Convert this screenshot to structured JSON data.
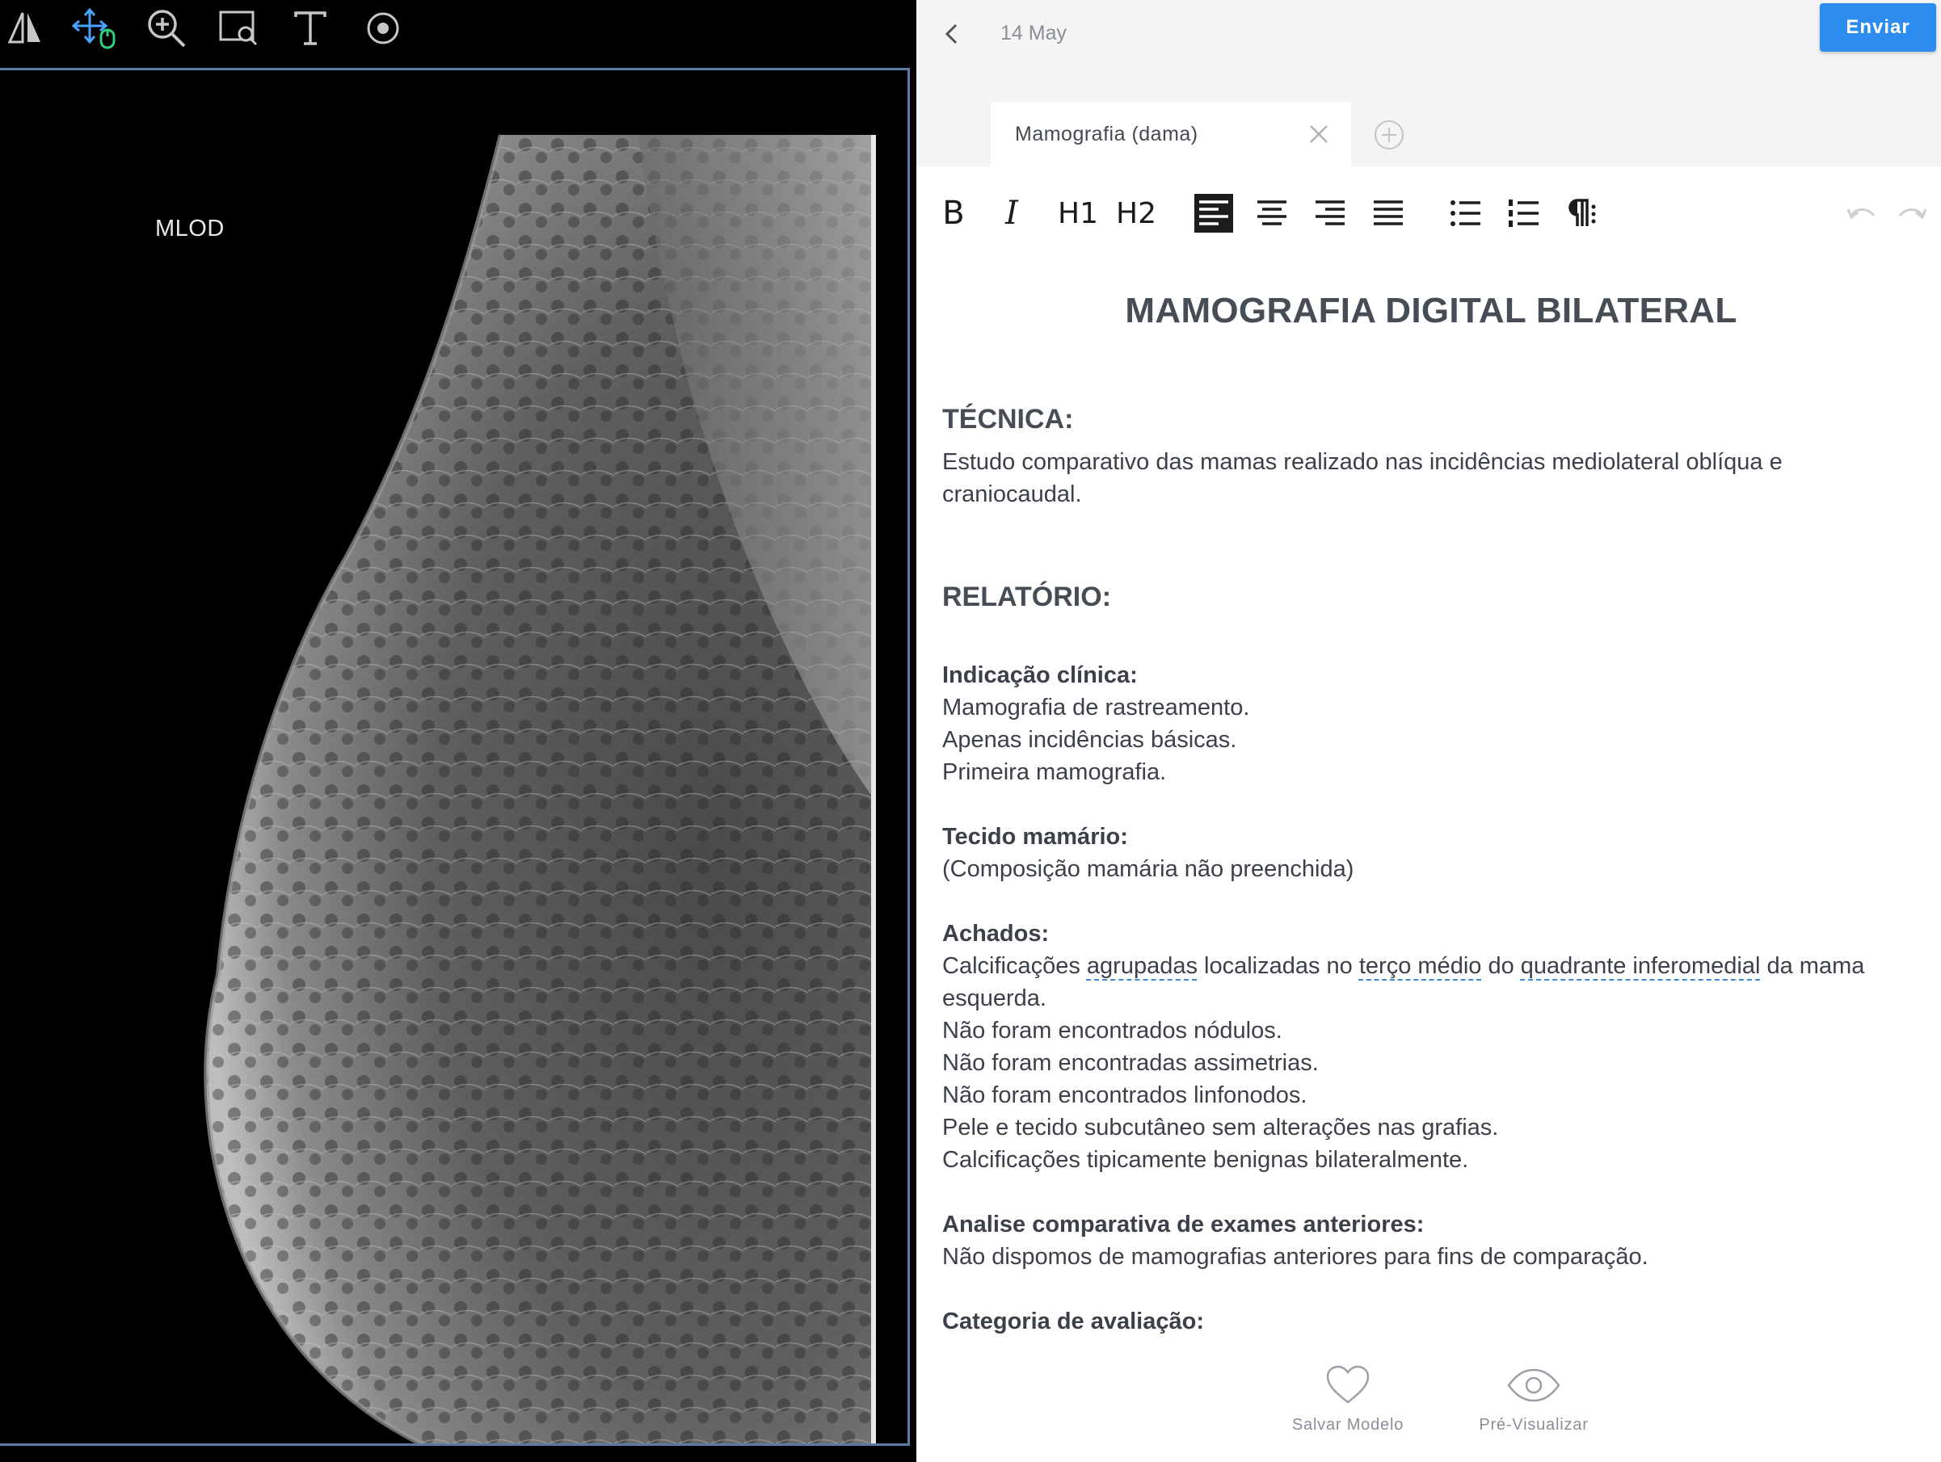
{
  "viewer": {
    "view_label": "MLOD",
    "tools": [
      "flip-icon",
      "pan-icon",
      "zoom-icon",
      "magnify-region-icon",
      "text-icon",
      "point-icon"
    ]
  },
  "editor": {
    "date": "14 May",
    "send_label": "Enviar",
    "tab_label": "Mamografia (dama)",
    "accent_color": "#2d8cf0",
    "toolbar": [
      "B",
      "I",
      "H1",
      "H2"
    ],
    "document": {
      "title": "MAMOGRAFIA DIGITAL BILATERAL",
      "tecnica_heading": "TÉCNICA:",
      "tecnica_text": "Estudo comparativo das mamas realizado nas incidências mediolateral oblíqua e craniocaudal.",
      "relatorio_heading": "RELATÓRIO:",
      "indicacao_label": "Indicação clínica:",
      "indicacao_lines": [
        "Mamografia de rastreamento.",
        "Apenas incidências básicas.",
        "Primeira mamografia."
      ],
      "tecido_label": "Tecido mamário:",
      "tecido_text": "(Composição mamária não preenchida)",
      "achados_label": "Achados:",
      "achados_first": {
        "w1": "Calcificações ",
        "w2": "agrupadas",
        "w3": " localizadas no ",
        "w4": "terço médio",
        "w5": " do ",
        "w6": "quadrante inferomedial",
        "w7": " da mama esquerda."
      },
      "achados_lines": [
        "Não foram encontrados nódulos.",
        "Não foram encontradas assimetrias.",
        "Não foram encontrados linfonodos.",
        "Pele e tecido subcutâneo sem alterações nas grafias.",
        "Calcificações tipicamente benignas bilateralmente."
      ],
      "analise_label": "Analise comparativa de exames anteriores:",
      "analise_text": "Não dispomos de mamografias anteriores para fins de comparação.",
      "categoria_label": "Categoria de avaliação:"
    },
    "actions": {
      "save_label": "Salvar Modelo",
      "preview_label": "Pré-Visualizar"
    }
  }
}
